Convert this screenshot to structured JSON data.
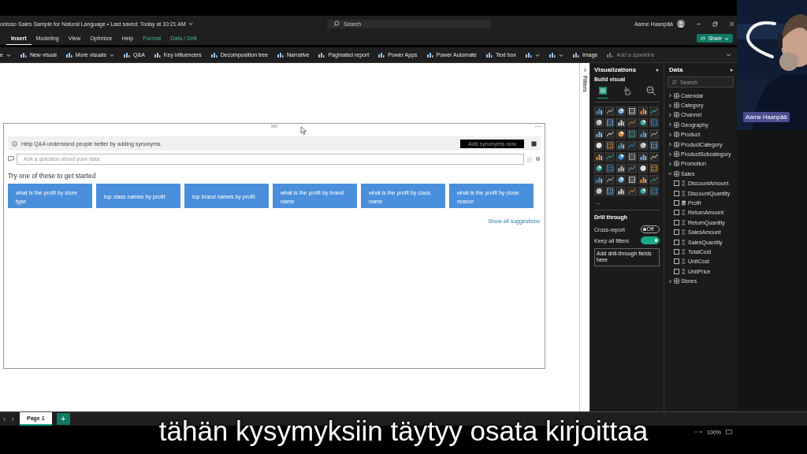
{
  "title_bar": {
    "document_title": "ontoso Sales Sample for Natural Language • Last saved: Today at 10:21 AM",
    "search_placeholder": "Search",
    "user": "Aarne Haanpää"
  },
  "ribbon_tabs": [
    {
      "label": "Insert",
      "selected": true,
      "kind": "main"
    },
    {
      "label": "Modeling",
      "selected": false,
      "kind": "main"
    },
    {
      "label": "View",
      "selected": false,
      "kind": "main"
    },
    {
      "label": "Optimize",
      "selected": false,
      "kind": "main"
    },
    {
      "label": "Help",
      "selected": false,
      "kind": "main"
    },
    {
      "label": "Format",
      "selected": false,
      "kind": "context"
    },
    {
      "label": "Data / Drill",
      "selected": false,
      "kind": "context"
    }
  ],
  "share_button": "Share",
  "toolbar": [
    {
      "label": "e",
      "dropdown": true,
      "disabled": false
    },
    {
      "label": "New visual",
      "dropdown": false,
      "disabled": false
    },
    {
      "label": "More visuals",
      "dropdown": true,
      "disabled": false
    },
    {
      "label": "Q&A",
      "dropdown": false,
      "disabled": false
    },
    {
      "label": "Key influencers",
      "dropdown": false,
      "disabled": false
    },
    {
      "label": "Decomposition tree",
      "dropdown": false,
      "disabled": false
    },
    {
      "label": "Narrative",
      "dropdown": false,
      "disabled": false
    },
    {
      "label": "Paginated report",
      "dropdown": false,
      "disabled": false
    },
    {
      "label": "Power Apps",
      "dropdown": false,
      "disabled": false
    },
    {
      "label": "Power Automate",
      "dropdown": false,
      "disabled": false
    },
    {
      "label": "Text box",
      "dropdown": false,
      "disabled": false
    },
    {
      "dropdown": true,
      "disabled": false
    },
    {
      "dropdown": true,
      "disabled": false
    },
    {
      "label": "Image",
      "dropdown": false,
      "disabled": false
    },
    {
      "label": "Add a sparkline",
      "dropdown": false,
      "disabled": true
    }
  ],
  "qna": {
    "banner": "Help Q&A understand people better by adding synonyms.",
    "banner_button": "Add synonyms now",
    "question_placeholder": "Ask a question about your data",
    "prompt": "Try one of these to get started",
    "suggestions": [
      "what is the profit by store type",
      "top class names by profit",
      "top brand names by profit",
      "what is the profit by brand name",
      "what is the profit by class name",
      "what is the profit by close reason"
    ],
    "show_all": "Show all suggestions"
  },
  "filters_label": "Filters",
  "visualizations": {
    "title": "Visualizations",
    "subtitle": "Build visual",
    "build_tabs": [
      {
        "selected": true
      },
      {
        "selected": false
      },
      {
        "selected": false
      }
    ],
    "more": "...",
    "drill_through": {
      "title": "Drill through",
      "options": [
        {
          "label": "Cross-report",
          "on": false,
          "state_text": "Off"
        },
        {
          "label": "Keep all filters",
          "on": true
        }
      ],
      "drop_zone": "Add drill-through fields here"
    }
  },
  "data": {
    "title": "Data",
    "search_placeholder": "Search",
    "tables": [
      {
        "name": "Calendar",
        "expanded": false
      },
      {
        "name": "Category",
        "expanded": false
      },
      {
        "name": "Channel",
        "expanded": false
      },
      {
        "name": "Geography",
        "expanded": false
      },
      {
        "name": "Product",
        "expanded": false
      },
      {
        "name": "ProductCategory",
        "expanded": false
      },
      {
        "name": "ProductSubcategory",
        "expanded": false
      },
      {
        "name": "Promotion",
        "expanded": false
      },
      {
        "name": "Sales",
        "expanded": true,
        "children": [
          {
            "name": "DiscountAmount",
            "checked": false,
            "kind": "sum"
          },
          {
            "name": "DiscountQuantity",
            "checked": false,
            "kind": "sum"
          },
          {
            "name": "Profit",
            "checked": false,
            "kind": "calc"
          },
          {
            "name": "ReturnAmount",
            "checked": false,
            "kind": "sum"
          },
          {
            "name": "ReturnQuantity",
            "checked": false,
            "kind": "sum"
          },
          {
            "name": "SalesAmount",
            "checked": false,
            "kind": "sum"
          },
          {
            "name": "SalesQuantity",
            "checked": false,
            "kind": "sum"
          },
          {
            "name": "TotalCost",
            "checked": false,
            "kind": "sum"
          },
          {
            "name": "UnitCost",
            "checked": false,
            "kind": "sum"
          },
          {
            "name": "UnitPrice",
            "checked": false,
            "kind": "sum"
          }
        ]
      },
      {
        "name": "Stores",
        "expanded": false
      }
    ]
  },
  "pages": [
    {
      "label": "Page 1",
      "selected": true
    }
  ],
  "add_page": "+",
  "zoom": "100%",
  "webcam": {
    "name": "Aarne Haanpää",
    "kind": "picture"
  },
  "subtitle": "tähän kysymyksiin täytyy osata kirjoittaa"
}
